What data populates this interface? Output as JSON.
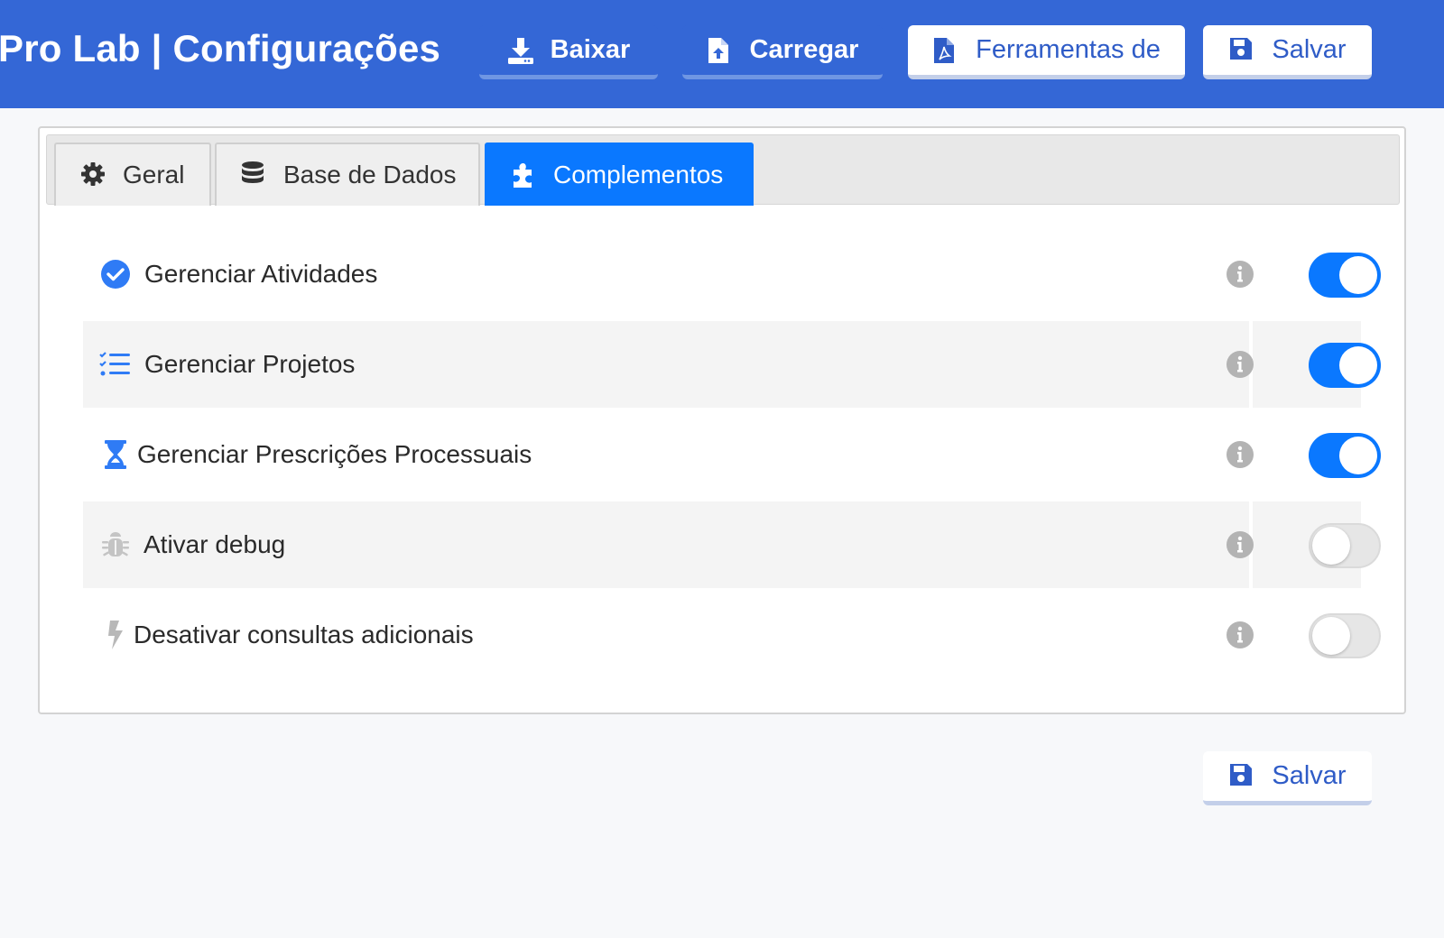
{
  "header": {
    "title": "Pro Lab | Configurações",
    "buttons": {
      "baixar": "Baixar",
      "carregar": "Carregar",
      "ferramentas": "Ferramentas de",
      "salvar": "Salvar"
    }
  },
  "tabs": [
    {
      "label": "Geral",
      "icon": "gear-icon",
      "active": false
    },
    {
      "label": "Base de Dados",
      "icon": "database-icon",
      "active": false
    },
    {
      "label": "Complementos",
      "icon": "puzzle-icon",
      "active": true
    }
  ],
  "settings": [
    {
      "label": "Gerenciar Atividades",
      "icon": "check-circle-icon",
      "enabled": true
    },
    {
      "label": "Gerenciar Projetos",
      "icon": "task-list-icon",
      "enabled": true
    },
    {
      "label": "Gerenciar Prescrições Processuais",
      "icon": "hourglass-icon",
      "enabled": true
    },
    {
      "label": "Ativar debug",
      "icon": "bug-icon",
      "enabled": false
    },
    {
      "label": "Desativar consultas adicionais",
      "icon": "lightning-icon",
      "enabled": false
    }
  ],
  "footer": {
    "save_label": "Salvar"
  },
  "colors": {
    "header": "#3467d6",
    "accent": "#0a78ff",
    "toggle_off": "#e6e6e6"
  }
}
